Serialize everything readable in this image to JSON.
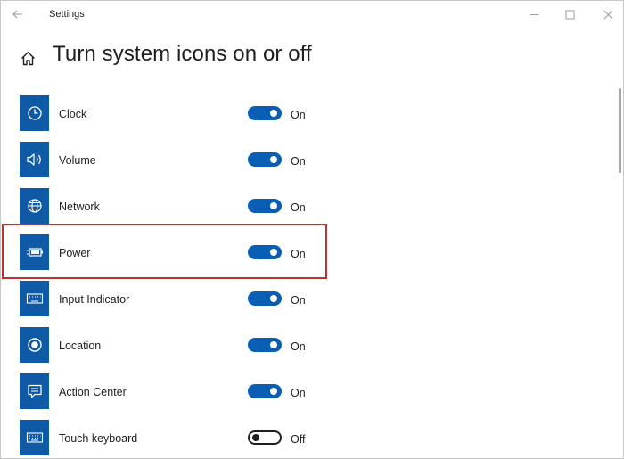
{
  "window": {
    "title": "Settings"
  },
  "page": {
    "title": "Turn system icons on or off"
  },
  "icons": {
    "back": "arrow-left-icon",
    "home": "home-icon",
    "minimize": "minimize-icon",
    "maximize": "maximize-icon",
    "close": "close-icon"
  },
  "colors": {
    "accent": "#0a5fb5",
    "tile": "#0f5aa7",
    "highlight": "#c0312f"
  },
  "items": [
    {
      "label": "Clock",
      "state": "On",
      "on": true,
      "icon": "clock-icon"
    },
    {
      "label": "Volume",
      "state": "On",
      "on": true,
      "icon": "volume-icon"
    },
    {
      "label": "Network",
      "state": "On",
      "on": true,
      "icon": "globe-icon"
    },
    {
      "label": "Power",
      "state": "On",
      "on": true,
      "icon": "battery-icon"
    },
    {
      "label": "Input Indicator",
      "state": "On",
      "on": true,
      "icon": "keyboard-icon"
    },
    {
      "label": "Location",
      "state": "On",
      "on": true,
      "icon": "location-icon"
    },
    {
      "label": "Action Center",
      "state": "On",
      "on": true,
      "icon": "action-center-icon"
    },
    {
      "label": "Touch keyboard",
      "state": "Off",
      "on": false,
      "icon": "keyboard-icon"
    }
  ]
}
